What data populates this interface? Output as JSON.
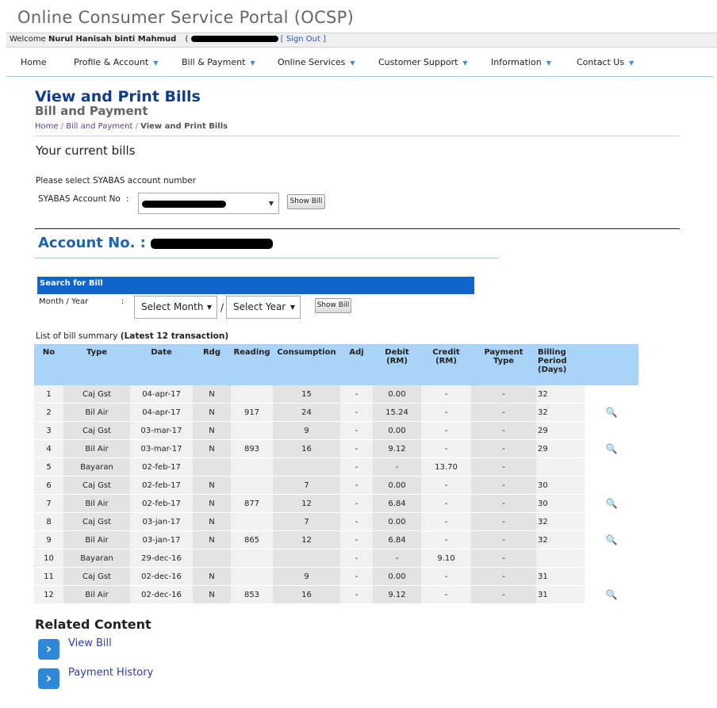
{
  "app": {
    "title": "Online Consumer Service Portal (OCSP)"
  },
  "welcome": {
    "prefix": "Welcome",
    "user": "Nurul Hanisah binti Mahmud",
    "open_paren": "(",
    "sign_out": "[ Sign Out ]"
  },
  "nav": {
    "items": [
      {
        "label": "Home",
        "caret": false
      },
      {
        "label": "Profile & Account",
        "caret": true
      },
      {
        "label": "Bill & Payment",
        "caret": true
      },
      {
        "label": "Online Services",
        "caret": true
      },
      {
        "label": "Customer Support",
        "caret": true
      },
      {
        "label": "Information",
        "caret": true
      },
      {
        "label": "Contact Us",
        "caret": true
      }
    ]
  },
  "page": {
    "title": "View and Print Bills",
    "subtitle": "Bill and Payment",
    "breadcrumb": {
      "home": "Home",
      "section": "Bill and Payment",
      "current": "View and Print Bills"
    },
    "current_bills": "Your current bills",
    "select_prompt": "Please select SYABAS account number",
    "account_label": "SYABAS Account No",
    "colon": ":",
    "show_bill": "Show Bill",
    "account_no_label": "Account No. :"
  },
  "search": {
    "title": "Search for Bill",
    "month_year_label": "Month / Year",
    "colon": ":",
    "month_placeholder": "Select Month",
    "year_placeholder": "Select Year",
    "separator": "/",
    "show_bill": "Show Bill"
  },
  "list": {
    "label": "List of bill summary",
    "label_bold": "(Latest 12 transaction)"
  },
  "table": {
    "headers": [
      "No",
      "Type",
      "Date",
      "Rdg",
      "Reading",
      "Consumption",
      "Adj",
      "Debit (RM)",
      "Credit (RM)",
      "Payment Type",
      "Billing Period (Days)",
      ""
    ],
    "rows": [
      [
        "1",
        "Caj Gst",
        "04-apr-17",
        "N",
        "",
        "15",
        "-",
        "0.00",
        "-",
        "-",
        "32",
        ""
      ],
      [
        "2",
        "Bil Air",
        "04-apr-17",
        "N",
        "917",
        "24",
        "-",
        "15.24",
        "-",
        "-",
        "32",
        "search"
      ],
      [
        "3",
        "Caj Gst",
        "03-mar-17",
        "N",
        "",
        "9",
        "-",
        "0.00",
        "-",
        "-",
        "29",
        ""
      ],
      [
        "4",
        "Bil Air",
        "03-mar-17",
        "N",
        "893",
        "16",
        "-",
        "9.12",
        "-",
        "-",
        "29",
        "search"
      ],
      [
        "5",
        "Bayaran",
        "02-feb-17",
        "",
        "",
        "",
        "-",
        "-",
        "13.70",
        "-",
        "",
        ""
      ],
      [
        "6",
        "Caj Gst",
        "02-feb-17",
        "N",
        "",
        "7",
        "-",
        "0.00",
        "-",
        "-",
        "30",
        ""
      ],
      [
        "7",
        "Bil Air",
        "02-feb-17",
        "N",
        "877",
        "12",
        "-",
        "6.84",
        "-",
        "-",
        "30",
        "search"
      ],
      [
        "8",
        "Caj Gst",
        "03-jan-17",
        "N",
        "",
        "7",
        "-",
        "0.00",
        "-",
        "-",
        "32",
        ""
      ],
      [
        "9",
        "Bil Air",
        "03-jan-17",
        "N",
        "865",
        "12",
        "-",
        "6.84",
        "-",
        "-",
        "32",
        "search"
      ],
      [
        "10",
        "Bayaran",
        "29-dec-16",
        "",
        "",
        "",
        "-",
        "-",
        "9.10",
        "-",
        "",
        ""
      ],
      [
        "11",
        "Caj Gst",
        "02-dec-16",
        "N",
        "",
        "9",
        "-",
        "0.00",
        "-",
        "-",
        "31",
        ""
      ],
      [
        "12",
        "Bil Air",
        "02-dec-16",
        "N",
        "853",
        "16",
        "-",
        "9.12",
        "-",
        "-",
        "31",
        "search"
      ]
    ]
  },
  "related": {
    "title": "Related Content",
    "items": [
      {
        "label": "View Bill",
        "icon": "chevron-right-icon"
      },
      {
        "label": "Payment History",
        "icon": "chevron-right-icon"
      }
    ]
  },
  "colors": {
    "brand_blue": "#0f3d8a",
    "accent_blue": "#1e64b0",
    "bar_blue": "#0f66c8",
    "header_blue": "#a9d3f7"
  }
}
